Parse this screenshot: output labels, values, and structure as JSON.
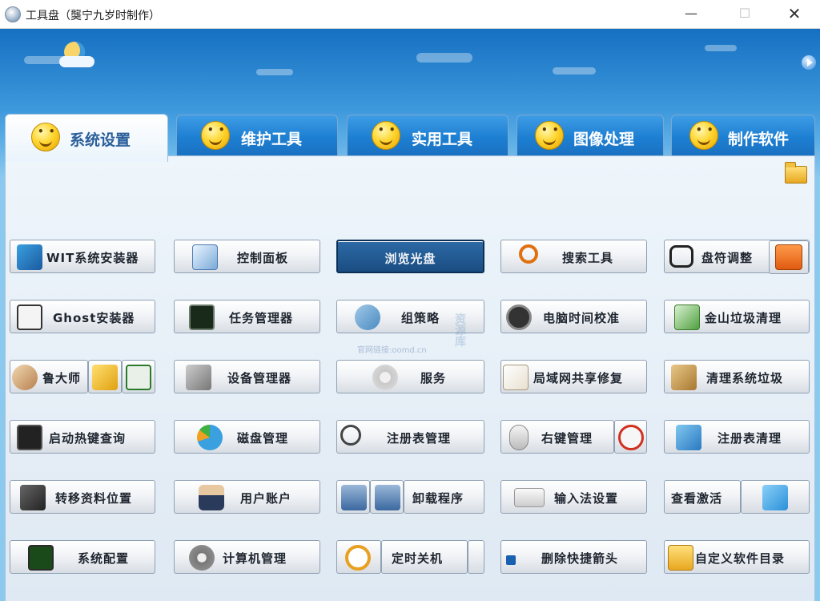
{
  "window": {
    "title": "工具盘（龑宁九岁时制作）",
    "min": "—",
    "max": "☐",
    "close": "✕"
  },
  "tabs": [
    {
      "label": "系统设置",
      "active": true
    },
    {
      "label": "维护工具"
    },
    {
      "label": "实用工具"
    },
    {
      "label": "图像处理"
    },
    {
      "label": "制作软件"
    }
  ],
  "grid": [
    [
      "WIT系统安装器",
      "控制面板",
      "浏览光盘",
      "搜索工具",
      "盘符调整"
    ],
    [
      "Ghost安装器",
      "任务管理器",
      "组策略",
      "电脑时间校准",
      "金山垃圾清理"
    ],
    [
      "鲁大师",
      "设备管理器",
      "服务",
      "局域网共享修复",
      "清理系统垃圾"
    ],
    [
      "启动热键查询",
      "磁盘管理",
      "注册表管理",
      "右键管理",
      "注册表清理"
    ],
    [
      "转移资料位置",
      "用户账户",
      "卸载程序",
      "输入法设置",
      "查看激活"
    ],
    [
      "系统配置",
      "计算机管理",
      "定时关机",
      "删除快捷箭头",
      "自定义软件目录"
    ]
  ],
  "watermark": {
    "text": "资源库",
    "sub": "官网链接:oomd.cn"
  },
  "colors": {
    "accent": "#1d7fd2",
    "panel": "#e8f1f9",
    "selected": "#1f5a94"
  }
}
